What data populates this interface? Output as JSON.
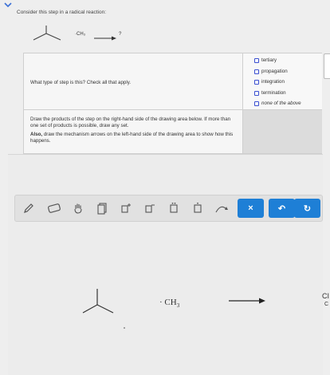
{
  "prompt": "Consider this step in a radical reaction:",
  "reaction": {
    "reagent": "·CH₃",
    "product": "?"
  },
  "question1": "What type of step is this? Check all that apply.",
  "options": [
    "tertiary",
    "propagation",
    "integration",
    "termination",
    "none of the above"
  ],
  "draw_instruction": "Draw the products of the step on the right-hand side of the drawing area below. If more than one set of products is possible, draw any set.",
  "draw_also_label": "Also,",
  "draw_also_text": " draw the mechanism arrows on the left-hand side of the drawing area to show how this happens.",
  "toolbar": {
    "clear_label": "×",
    "undo_label": "↶",
    "redo_label": "↻"
  },
  "canvas": {
    "radical_dot": "·",
    "radical_ch": "CH",
    "radical_sub": "3",
    "cut_text_1": "CI",
    "cut_text_2": "C"
  },
  "colors": {
    "accent": "#1e7fd6",
    "checkbox_border": "#3a4fd0"
  }
}
